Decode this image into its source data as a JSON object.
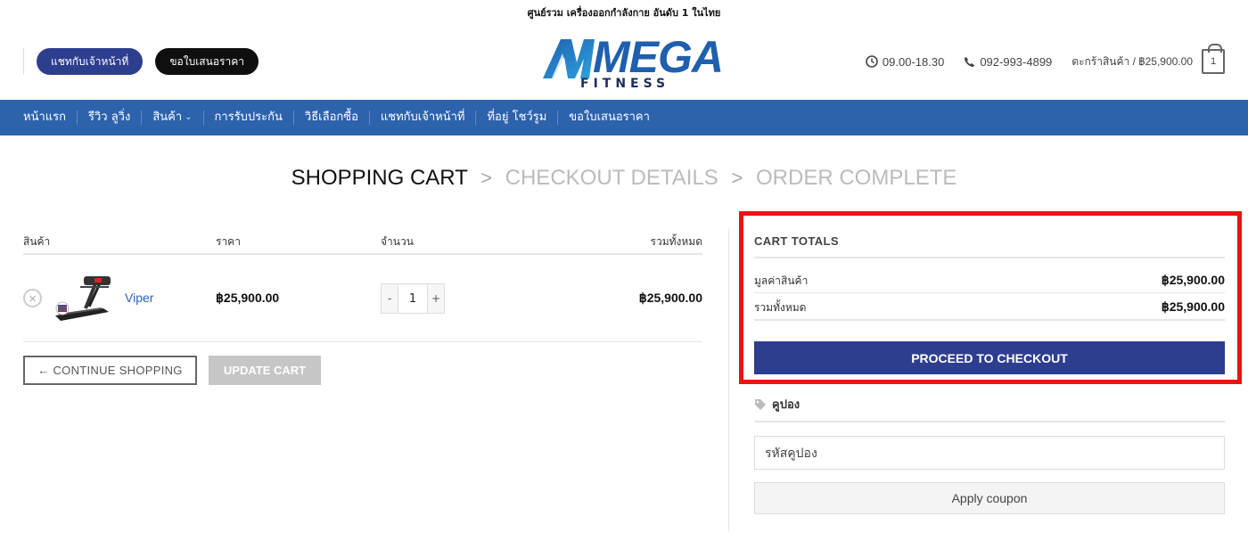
{
  "topbar": {
    "text": "ศูนย์รวม เครื่องออกกำลังกาย อันดับ 1 ในไทย"
  },
  "header": {
    "chat_button": "แชทกับเจ้าหน้าที่",
    "quote_button": "ขอใบเสนอราคา",
    "logo": {
      "main": "MEGA",
      "sub": "FITNESS"
    },
    "hours": "09.00-18.30",
    "phone": "092-993-4899",
    "cart_label": "ตะกร้าสินค้า / ฿25,900.00",
    "cart_count": "1",
    "icons": [
      "clock-icon",
      "phone-icon",
      "cart-bag-icon"
    ]
  },
  "nav": {
    "items": [
      {
        "label": "หน้าแรก"
      },
      {
        "label": "รีวิว ลูวิ่ง"
      },
      {
        "label": "สินค้า",
        "chevron": "⌄"
      },
      {
        "label": "การรับประกัน"
      },
      {
        "label": "วิธีเลือกซื้อ"
      },
      {
        "label": "แชทกับเจ้าหน้าที่"
      },
      {
        "label": "ที่อยู่ โชว์รูม"
      },
      {
        "label": "ขอใบเสนอราคา"
      }
    ]
  },
  "steps": {
    "current": "SHOPPING CART",
    "sep": ">",
    "second": "CHECKOUT DETAILS",
    "third": "ORDER COMPLETE"
  },
  "cart": {
    "headers": {
      "product": "สินค้า",
      "price": "ราคา",
      "quantity": "จำนวน",
      "subtotal": "รวมทั้งหมด"
    },
    "items": [
      {
        "remove": "×",
        "name": "Viper",
        "price": "฿25,900.00",
        "minus": "-",
        "qty": "1",
        "plus": "+",
        "subtotal": "฿25,900.00"
      }
    ],
    "continue_label": "← CONTINUE SHOPPING",
    "update_label": "UPDATE CART"
  },
  "totals": {
    "title": "CART TOTALS",
    "subtotal_label": "มูลค่าสินค้า",
    "subtotal_value": "฿25,900.00",
    "total_label": "รวมทั้งหมด",
    "total_value": "฿25,900.00",
    "checkout_label": "PROCEED TO CHECKOUT"
  },
  "coupon": {
    "title": "คูปอง",
    "placeholder": "รหัสคูปอง",
    "apply_label": "Apply coupon"
  },
  "colors": {
    "primary": "#2d3e8f",
    "nav": "#2d62ad",
    "highlight": "#ee1111"
  }
}
